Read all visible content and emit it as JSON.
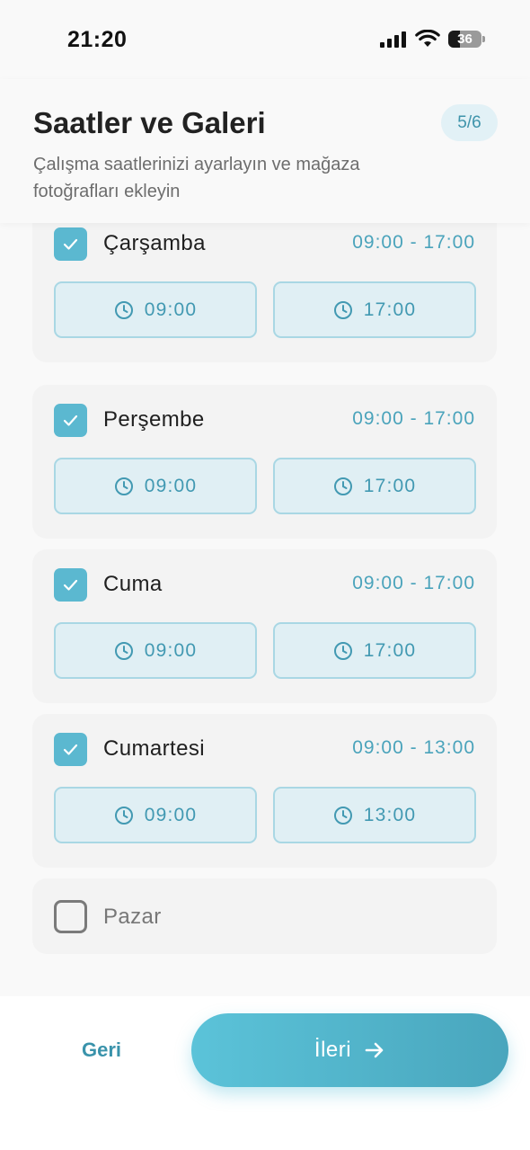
{
  "status_bar": {
    "time": "21:20",
    "battery_level": "36",
    "icons": [
      "cellular-signal-icon",
      "wifi-icon",
      "battery-icon"
    ]
  },
  "header": {
    "title": "Saatler ve Galeri",
    "subtitle": "Çalışma saatlerinizi ayarlayın ve mağaza fotoğrafları ekleyin",
    "step": "5/6"
  },
  "days": [
    {
      "name": "Çarşamba",
      "range": "09:00 - 17:00",
      "start": "09:00",
      "end": "17:00",
      "checked": true
    },
    {
      "name": "Perşembe",
      "range": "09:00 - 17:00",
      "start": "09:00",
      "end": "17:00",
      "checked": true
    },
    {
      "name": "Cuma",
      "range": "09:00 - 17:00",
      "start": "09:00",
      "end": "17:00",
      "checked": true
    },
    {
      "name": "Cumartesi",
      "range": "09:00 - 13:00",
      "start": "09:00",
      "end": "13:00",
      "checked": true
    },
    {
      "name": "Pazar",
      "checked": false
    }
  ],
  "footer": {
    "back_label": "Geri",
    "next_label": "İleri"
  },
  "colors": {
    "accent": "#5bb8d0",
    "accent_text": "#4aa3bb",
    "time_button_bg": "#e0eff4",
    "card_bg": "#f3f3f3"
  }
}
